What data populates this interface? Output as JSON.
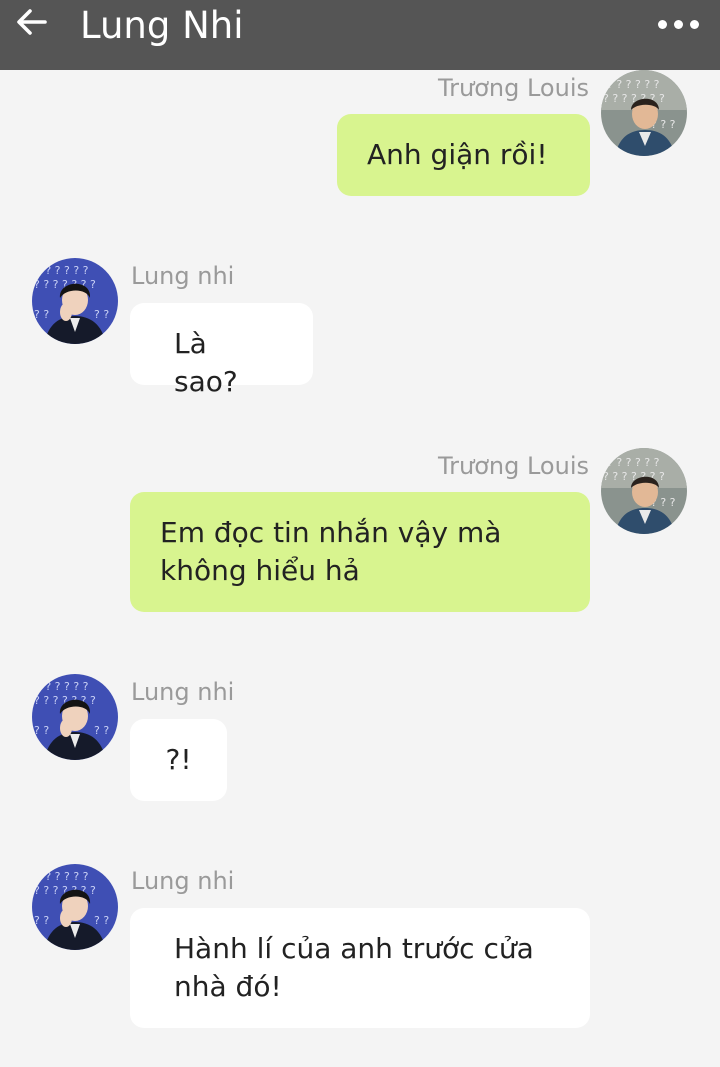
{
  "header": {
    "title": "Lung Nhi",
    "back_icon": "arrow-left-icon",
    "menu_icon": "more-horizontal-icon"
  },
  "colors": {
    "header_bg": "#555555",
    "page_bg": "#f4f4f4",
    "sent_bubble": "#d8f48f",
    "received_bubble": "#ffffff",
    "name_text": "#9a9a9a"
  },
  "messages": [
    {
      "sender": "Trương Louis",
      "side": "right",
      "text": "Anh giận rồi!"
    },
    {
      "sender": "Lung nhi",
      "side": "left",
      "text": "Là sao?"
    },
    {
      "sender": "Trương Louis",
      "side": "right",
      "text": "Em đọc tin nhắn vậy mà không hiểu hả"
    },
    {
      "sender": "Lung nhi",
      "side": "left",
      "text": "?!"
    },
    {
      "sender": "Lung nhi",
      "side": "left",
      "text": "Hành lí của anh trước cửa nhà đó!"
    }
  ]
}
